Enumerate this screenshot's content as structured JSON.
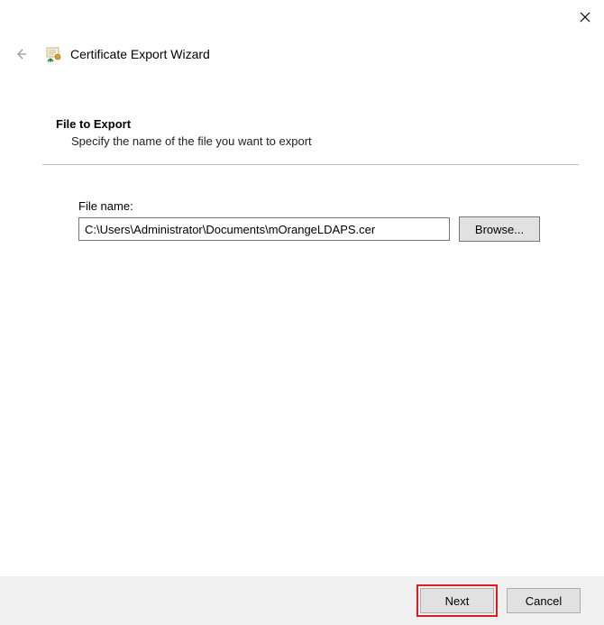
{
  "titlebar": {
    "close_icon": "×"
  },
  "header": {
    "wizard_title": "Certificate Export Wizard"
  },
  "section": {
    "heading": "File to Export",
    "subtext": "Specify the name of the file you want to export"
  },
  "file": {
    "label": "File name:",
    "value": "C:\\Users\\Administrator\\Documents\\mOrangeLDAPS.cer",
    "browse_label": "Browse..."
  },
  "footer": {
    "next_label": "Next",
    "cancel_label": "Cancel"
  }
}
